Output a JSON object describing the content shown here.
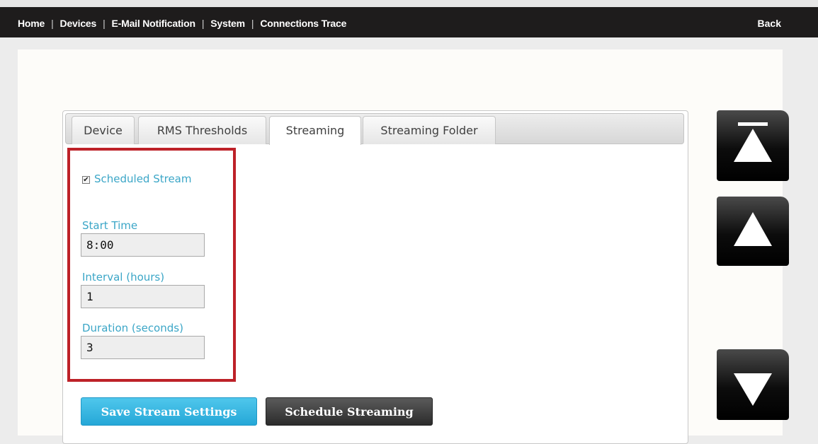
{
  "nav": {
    "items": [
      "Home",
      "Devices",
      "E-Mail Notification",
      "System",
      "Connections Trace"
    ],
    "separator": "|",
    "back_label": "Back"
  },
  "tabs": [
    {
      "label": "Device",
      "active": false
    },
    {
      "label": "RMS Thresholds",
      "active": false
    },
    {
      "label": "Streaming",
      "active": true
    },
    {
      "label": "Streaming Folder",
      "active": false
    }
  ],
  "form": {
    "scheduled_stream": {
      "label": "Scheduled Stream",
      "checked": true
    },
    "start_time": {
      "label": "Start Time",
      "value": "8:00"
    },
    "interval": {
      "label": "Interval (hours)",
      "value": "1"
    },
    "duration": {
      "label": "Duration (seconds)",
      "value": "3"
    }
  },
  "buttons": {
    "save": "Save Stream Settings",
    "schedule": "Schedule Streaming"
  },
  "scroll_controls": {
    "icons": [
      "scroll-to-top-icon",
      "scroll-up-icon",
      "scroll-down-icon"
    ]
  },
  "colors": {
    "topbar": "#1e1c1c",
    "label_accent": "#3ba6c7",
    "highlight_box": "#bd2128",
    "save_button": "#25a7d7",
    "schedule_button": "#2b2b2b"
  }
}
